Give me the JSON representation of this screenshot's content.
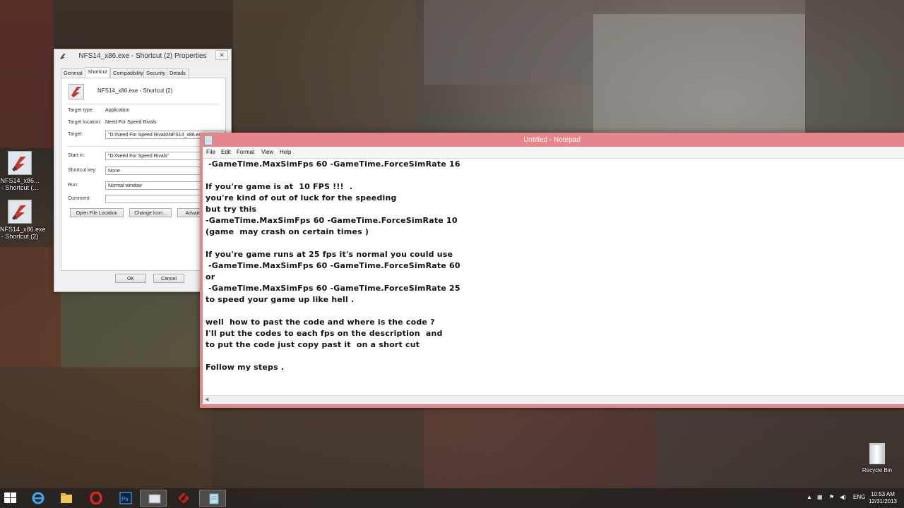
{
  "props": {
    "title": "NFS14_x86.exe - Shortcut (2) Properties",
    "close": "✕",
    "tabs": [
      "General",
      "Shortcut",
      "Compatibility",
      "Security",
      "Details"
    ],
    "active_tab": "Shortcut",
    "shortcut_name": "NFS14_x86.exe - Shortcut (2)",
    "target_type_label": "Target type:",
    "target_type": "Application",
    "target_location_label": "Target location:",
    "target_location": "Need For Speed Rivals",
    "target_label": "Target:",
    "target_value": "\"D:\\Need For Speed Rivals\\NFS14_x86.exe\"",
    "start_in_label": "Start in:",
    "start_in_value": "\"D:\\Need For Speed Rivals\"",
    "shortcut_key_label": "Shortcut key:",
    "shortcut_key_value": "None",
    "run_label": "Run:",
    "run_value": "Normal window",
    "comment_label": "Comment:",
    "comment_value": "",
    "open_file_location": "Open File Location",
    "change_icon": "Change Icon...",
    "advanced": "Advanced...",
    "ok": "OK",
    "cancel": "Cancel"
  },
  "desktop_icons": [
    {
      "line1": "NFS14_x86...",
      "line2": "- Shortcut (..."
    },
    {
      "line1": "NFS14_x86.exe",
      "line2": "- Shortcut (2)"
    }
  ],
  "notepad": {
    "title": "Untitled - Notepad",
    "menu": [
      "File",
      "Edit",
      "Format",
      "View",
      "Help"
    ],
    "lines": [
      " -GameTime.MaxSimFps 60 -GameTime.ForceSimRate 16",
      "",
      "If you're game is at  10 FPS !!!  .",
      "you're kind of out of luck for the speeding",
      "but try this",
      "-GameTime.MaxSimFps 60 -GameTime.ForceSimRate 10",
      "(game  may crash on certain times )",
      "",
      "If you're game runs at 25 fps it's normal you could use",
      " -GameTime.MaxSimFps 60 -GameTime.ForceSimRate 60",
      "or",
      " -GameTime.MaxSimFps 60 -GameTime.ForceSimRate 25",
      "to speed your game up like hell .",
      "",
      "well  how to past the code and where is the code ?",
      "I'll put the codes to each fps on the description  and",
      "to put the code just copy past it  on a short cut",
      "",
      "Follow my steps ."
    ]
  },
  "recycle_bin": "Recycle Bin",
  "taskbar": {
    "language": "ENG",
    "time": "10:53 AM",
    "date": "12/31/2013"
  }
}
